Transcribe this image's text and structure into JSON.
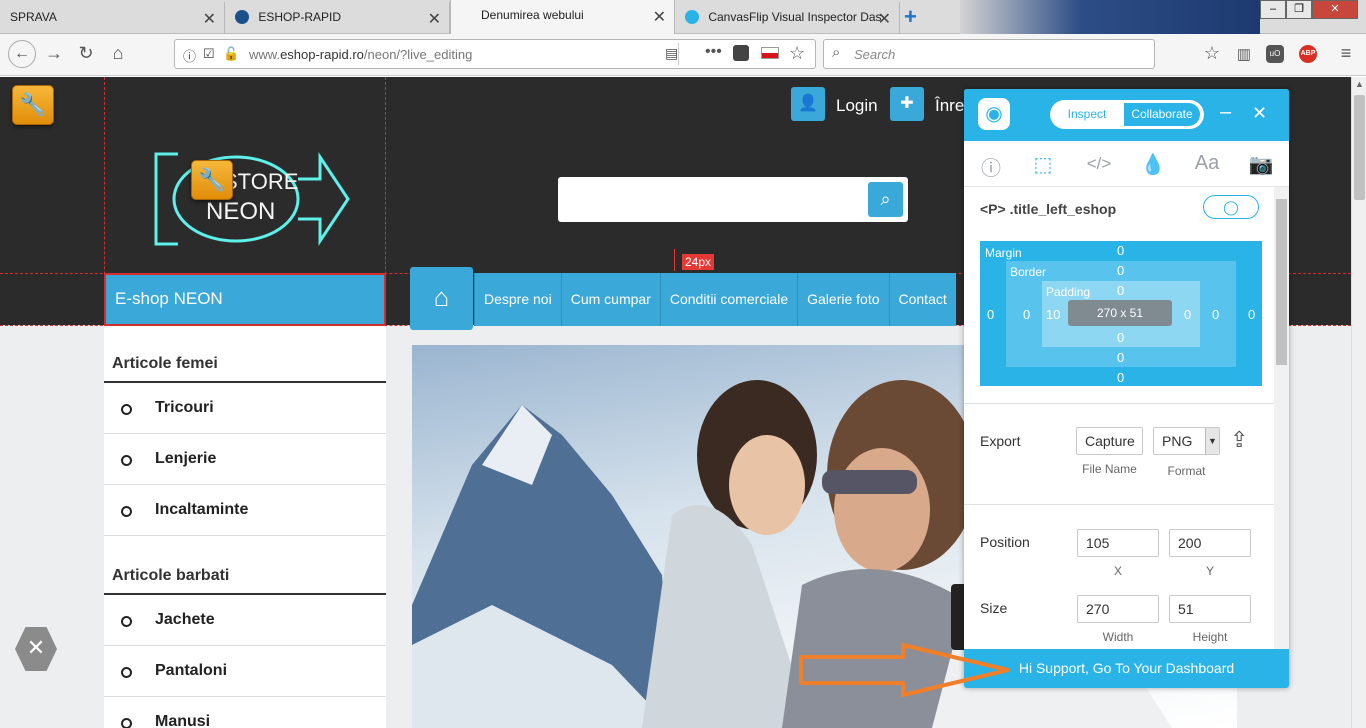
{
  "browser": {
    "tabs": [
      {
        "title": "SPRAVA"
      },
      {
        "title": "ESHOP-RAPID"
      },
      {
        "title": "Denumirea webului"
      },
      {
        "title": "CanvasFlip Visual Inspector Das"
      }
    ],
    "url_prefix": "www.",
    "url_domain": "eshop-rapid.ro",
    "url_path": "/neon/?live_editing",
    "search_placeholder": "Search",
    "abp_label": "ABP",
    "ub_label": "uO"
  },
  "site": {
    "logo_line1": "STORE",
    "logo_line2": "NEON",
    "login_label": "Login",
    "register_label": "Înreg",
    "left_category": "E-shop NEON",
    "spacing_badge": "24px",
    "menu": [
      "Despre noi",
      "Cum cumpar",
      "Conditii comerciale",
      "Galerie foto",
      "Contact"
    ],
    "sections": [
      {
        "title": "Articole femei",
        "items": [
          "Tricouri",
          "Lenjerie",
          "Incaltaminte"
        ]
      },
      {
        "title": "Articole barbati",
        "items": [
          "Jachete",
          "Pantaloni",
          "Manusi"
        ]
      }
    ]
  },
  "inspector": {
    "toggle_inspect": "Inspect",
    "toggle_collaborate": "Collaborate",
    "selected_element": "<P> .title_left_eshop",
    "box": {
      "margin_label": "Margin",
      "border_label": "Border",
      "padding_label": "Padding",
      "margin": {
        "top": "0",
        "right": "0",
        "bottom": "0",
        "left": "0"
      },
      "border": {
        "top": "0",
        "right": "0",
        "bottom": "0",
        "left": "0"
      },
      "padding": {
        "top": "0",
        "right": "0",
        "bottom": "0",
        "left": "10"
      },
      "content": "270 x 51"
    },
    "export_label": "Export",
    "file_name_value": "Capture",
    "file_name_label": "File Name",
    "format_value": "PNG",
    "format_label": "Format",
    "position_label": "Position",
    "pos_x": "105",
    "pos_y": "200",
    "x_label": "X",
    "y_label": "Y",
    "size_label": "Size",
    "width_value": "270",
    "height_value": "51",
    "width_label": "Width",
    "height_label": "Height",
    "footer": "Hi Support, Go To Your Dashboard"
  },
  "colors": {
    "accent": "#29b3e6",
    "site_blue": "#3aa8d8",
    "header_dark": "#2b2b2b",
    "guide_red": "#d32f2f",
    "arrow_orange": "#f07f2a"
  }
}
